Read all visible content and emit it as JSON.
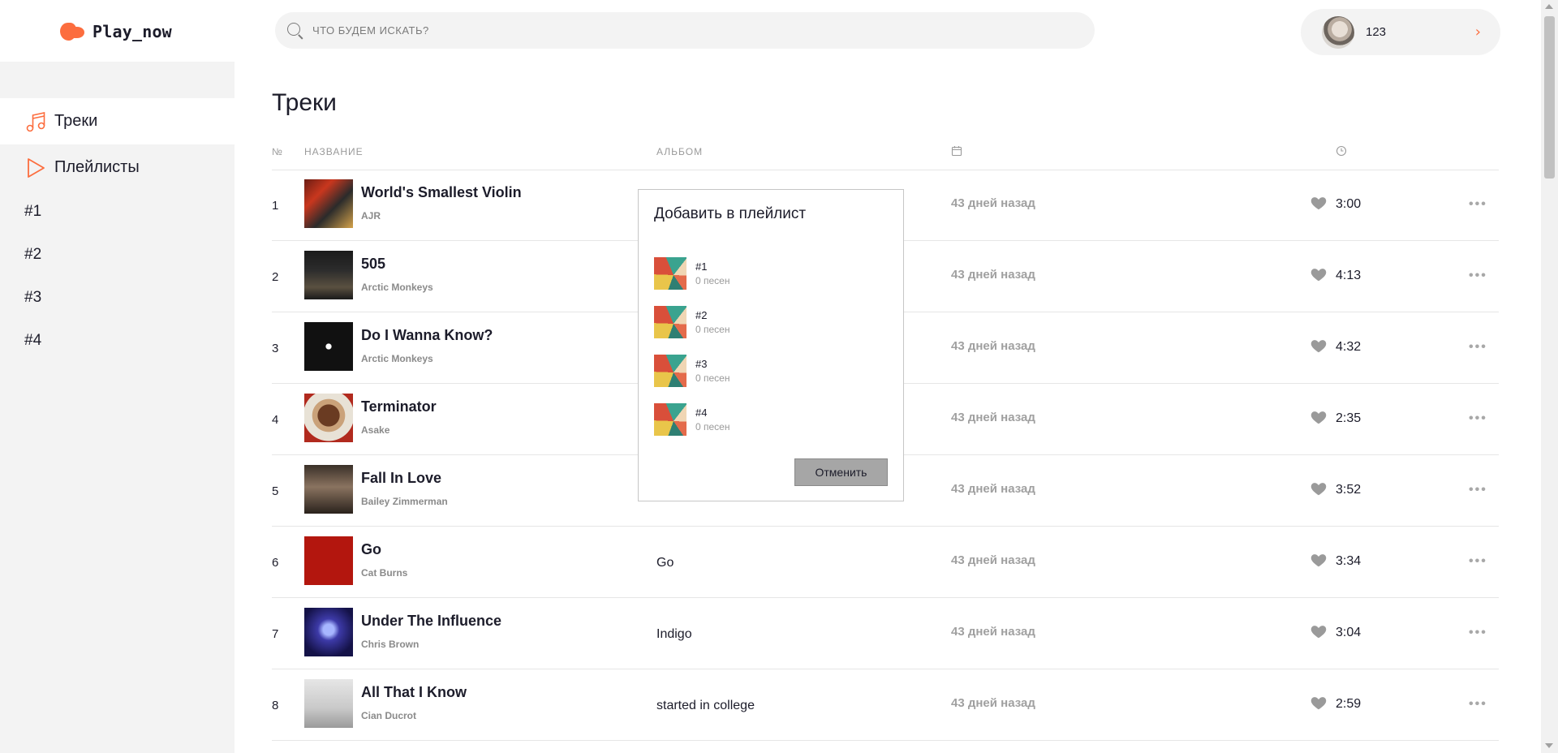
{
  "app": {
    "logo_text": "Play_now",
    "accent_color": "#fc6d3e"
  },
  "search": {
    "placeholder": "ЧТО БУДЕМ ИСКАТЬ?",
    "value": ""
  },
  "user": {
    "name": "123",
    "arrow": "›"
  },
  "sidebar": {
    "nav": [
      {
        "label": "Треки",
        "icon": "music-note-icon",
        "active": true
      },
      {
        "label": "Плейлисты",
        "icon": "play-icon",
        "active": false
      }
    ],
    "playlists": [
      "#1",
      "#2",
      "#3",
      "#4"
    ]
  },
  "main": {
    "title": "Треки",
    "columns": {
      "num": "№",
      "name": "НАЗВАНИЕ",
      "album": "АЛЬБОМ",
      "date_icon": "calendar-icon",
      "duration_icon": "clock-icon"
    },
    "tracks": [
      {
        "num": "1",
        "title": "World's Smallest Violin",
        "artist": "AJR",
        "album": "",
        "date": "43 дней назад",
        "duration": "3:00"
      },
      {
        "num": "2",
        "title": "505",
        "artist": "Arctic Monkeys",
        "album": "",
        "date": "43 дней назад",
        "duration": "4:13"
      },
      {
        "num": "3",
        "title": "Do I Wanna Know?",
        "artist": "Arctic Monkeys",
        "album": "",
        "date": "43 дней назад",
        "duration": "4:32"
      },
      {
        "num": "4",
        "title": "Terminator",
        "artist": "Asake",
        "album": "",
        "date": "43 дней назад",
        "duration": "2:35"
      },
      {
        "num": "5",
        "title": "Fall In Love",
        "artist": "Bailey Zimmerman",
        "album": "",
        "date": "43 дней назад",
        "duration": "3:52"
      },
      {
        "num": "6",
        "title": "Go",
        "artist": "Cat Burns",
        "album": "Go",
        "date": "43 дней назад",
        "duration": "3:34"
      },
      {
        "num": "7",
        "title": "Under The Influence",
        "artist": "Chris Brown",
        "album": "Indigo",
        "date": "43 дней назад",
        "duration": "3:04"
      },
      {
        "num": "8",
        "title": "All That I Know",
        "artist": "Cian Ducrot",
        "album": "started in college",
        "date": "43 дней назад",
        "duration": "2:59"
      }
    ],
    "more_label": "•••"
  },
  "modal": {
    "title": "Добавить в плейлист",
    "playlists": [
      {
        "name": "#1",
        "count": "0 песен"
      },
      {
        "name": "#2",
        "count": "0 песен"
      },
      {
        "name": "#3",
        "count": "0 песен"
      },
      {
        "name": "#4",
        "count": "0 песен"
      }
    ],
    "cancel_label": "Отменить"
  }
}
